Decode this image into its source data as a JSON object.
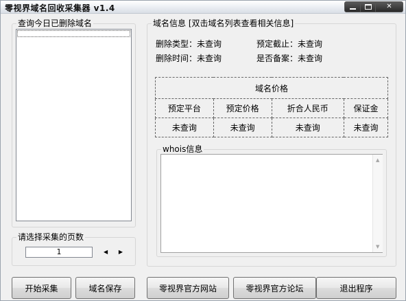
{
  "window": {
    "title": "零视界域名回收采集器 v1.4"
  },
  "left_panel": {
    "group_label": "查询今日已删除域名",
    "domain_list": []
  },
  "page_select": {
    "label": "请选择采集的页数",
    "value": "1",
    "spin_left_icon": "arrow-left-icon",
    "spin_right_icon": "arrow-right-icon"
  },
  "domain_info": {
    "group_label": "域名信息 [双击域名列表查看相关信息]",
    "delete_type_label": "删除类型：",
    "delete_type_value": "未查询",
    "reserve_deadline_label": "预定截止：",
    "reserve_deadline_value": "未查询",
    "delete_time_label": "删除时间：",
    "delete_time_value": "未查询",
    "filing_label": "是否备案：",
    "filing_value": "未查询"
  },
  "price_table": {
    "title": "域名价格",
    "headers": [
      "预定平台",
      "预定价格",
      "折合人民币",
      "保证金"
    ],
    "values": [
      "未查询",
      "未查询",
      "未查询",
      "未查询"
    ]
  },
  "whois": {
    "group_label": "whois信息",
    "content": ""
  },
  "buttons": {
    "start": "开始采集",
    "save": "域名保存",
    "website": "零视界官方网站",
    "forum": "零视界官方论坛",
    "exit": "退出程序"
  }
}
